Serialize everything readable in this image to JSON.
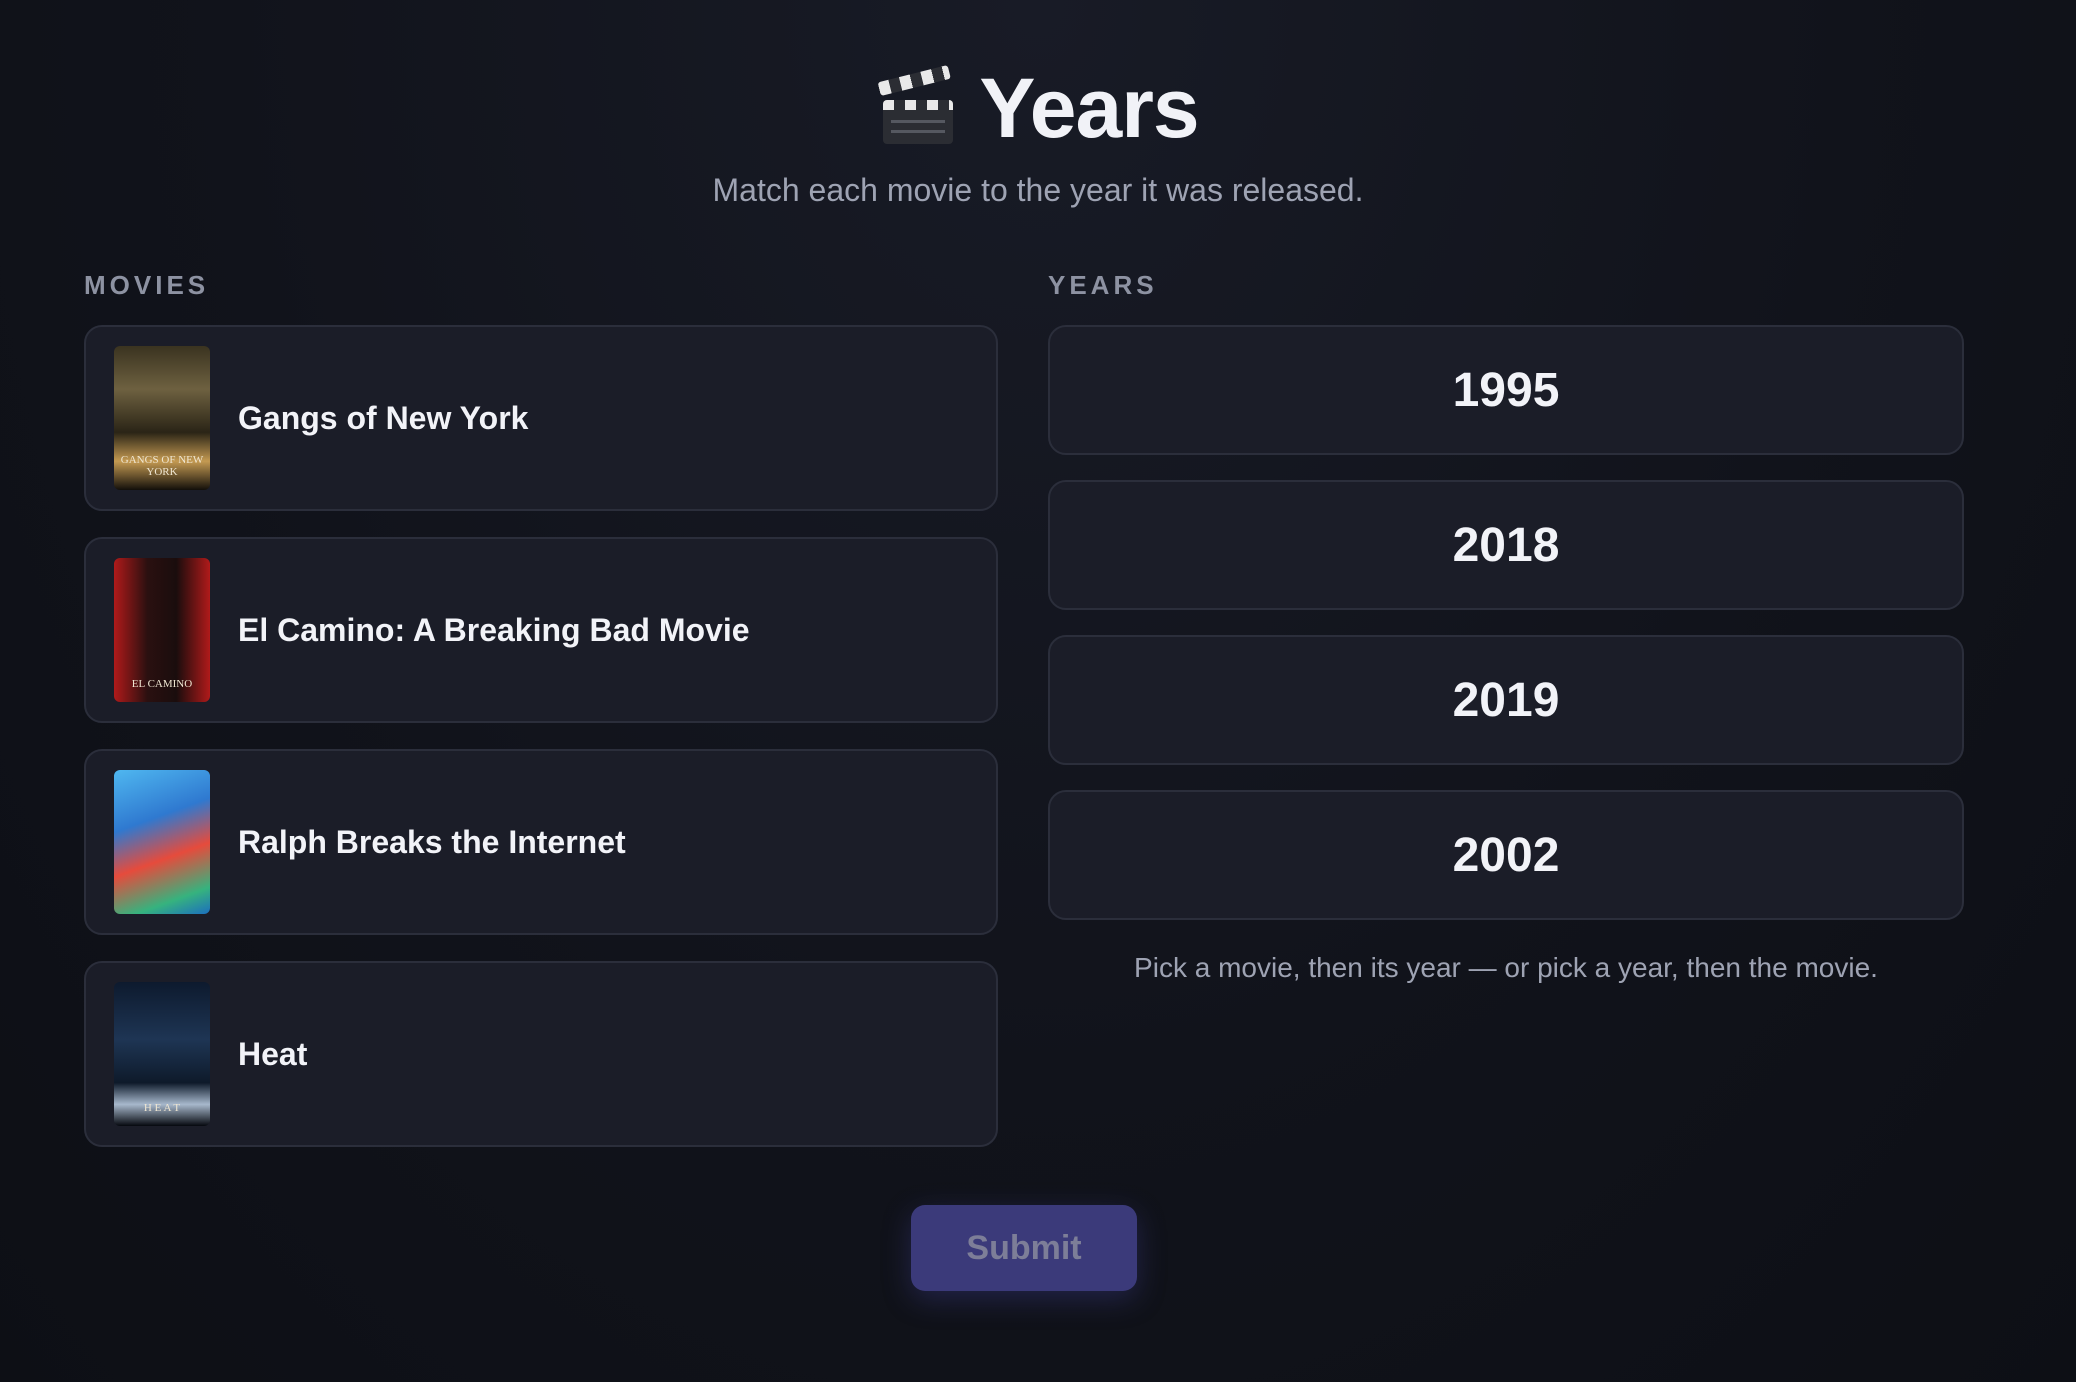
{
  "header": {
    "title": "Years",
    "icon": "clapperboard-icon",
    "subtitle": "Match each movie to the year it was released."
  },
  "movies_column": {
    "label": "MOVIES",
    "items": [
      {
        "title": "Gangs of New York",
        "poster_text": "GANGS OF NEW YORK"
      },
      {
        "title": "El Camino: A Breaking Bad Movie",
        "poster_text": "EL CAMINO"
      },
      {
        "title": "Ralph Breaks the Internet",
        "poster_text": ""
      },
      {
        "title": "Heat",
        "poster_text": "H E A T"
      }
    ]
  },
  "years_column": {
    "label": "YEARS",
    "items": [
      "1995",
      "2018",
      "2019",
      "2002"
    ],
    "hint": "Pick a movie, then its year — or pick a year, then the movie."
  },
  "submit_label": "Submit"
}
